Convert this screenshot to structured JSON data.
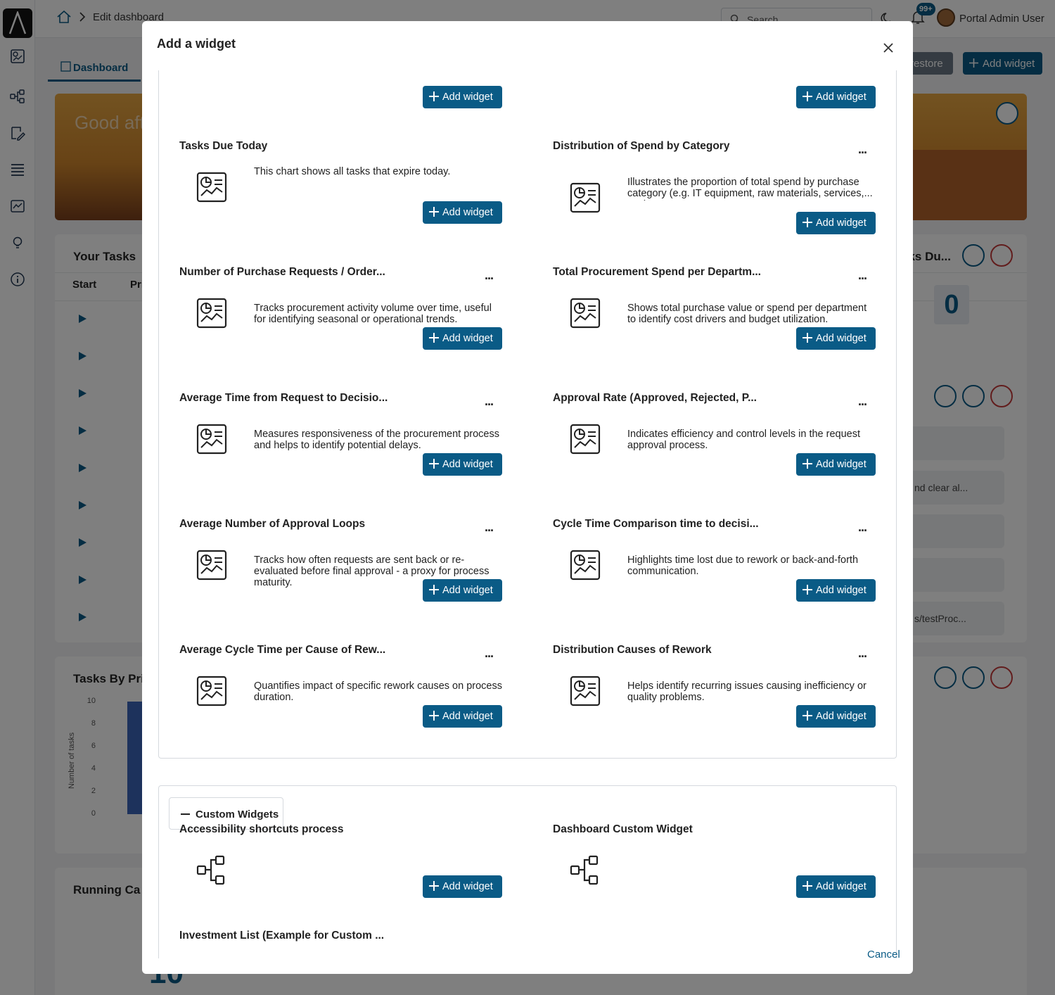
{
  "app": {
    "breadcrumb": "Edit dashboard",
    "search_placeholder": "Search",
    "notification_count": "99+",
    "user_name": "Portal Admin User",
    "tab_dashboard": "Dashboard",
    "restore_label": "restore",
    "add_widget_label": "Add widget",
    "hero_text": "Good aft",
    "your_tasks_title": "Your Tasks",
    "col_start": "Start",
    "col_pri": "Pri",
    "tasks_due_title": "sks Du...",
    "tasks_due_value": "0",
    "tasks_by_title": "Tasks By Pri",
    "y_axis_label": "Number of tasks",
    "y_ticks": [
      "10",
      "8",
      "6",
      "4",
      "2",
      "0"
    ],
    "running_title": "Running Ca",
    "list_snippet_1": "nd clear al...",
    "list_snippet_2": "s/testProc...",
    "bottom_number": "10"
  },
  "modal": {
    "title": "Add a widget",
    "cancel_label": "Cancel",
    "add_label": "Add widget",
    "custom_section_label": "Custom Widgets",
    "widgets": [
      {
        "title": "Tasks Due Today",
        "desc": "This chart shows all tasks that expire today."
      },
      {
        "title": "Distribution of Spend by Category",
        "desc": "Illustrates the proportion of total spend by purchase category (e.g. IT equipment, raw materials, services,... etc.)"
      },
      {
        "title": "Number of Purchase Requests / Order...",
        "desc": "Tracks procurement activity volume over time, useful for identifying seasonal or operational trends."
      },
      {
        "title": "Total Procurement Spend per Departm...",
        "desc": "Shows total purchase value or spend per department to identify cost drivers and budget utilization."
      },
      {
        "title": "Average Time from Request to Decisio...",
        "desc": "Measures responsiveness of the procurement process and helps to identify potential delays."
      },
      {
        "title": "Approval Rate (Approved, Rejected, P...",
        "desc": "Indicates efficiency and control levels in the request approval process."
      },
      {
        "title": "Average Number of Approval Loops",
        "desc": "Tracks how often requests are sent back or re-evaluated before final approval - a proxy for process maturity."
      },
      {
        "title": "Cycle Time Comparison time to decisi...",
        "desc": "Highlights time lost due to rework or back-and-forth communication."
      },
      {
        "title": "Average Cycle Time per Cause of Rew...",
        "desc": "Quantifies impact of specific rework causes on process duration."
      },
      {
        "title": "Distribution Causes of Rework",
        "desc": "Helps identify recurring issues causing inefficiency or quality problems."
      }
    ],
    "custom_widgets": [
      {
        "title": "Accessibility shortcuts process"
      },
      {
        "title": "Dashboard Custom Widget"
      },
      {
        "title": "Investment List (Example for Custom ..."
      }
    ]
  }
}
